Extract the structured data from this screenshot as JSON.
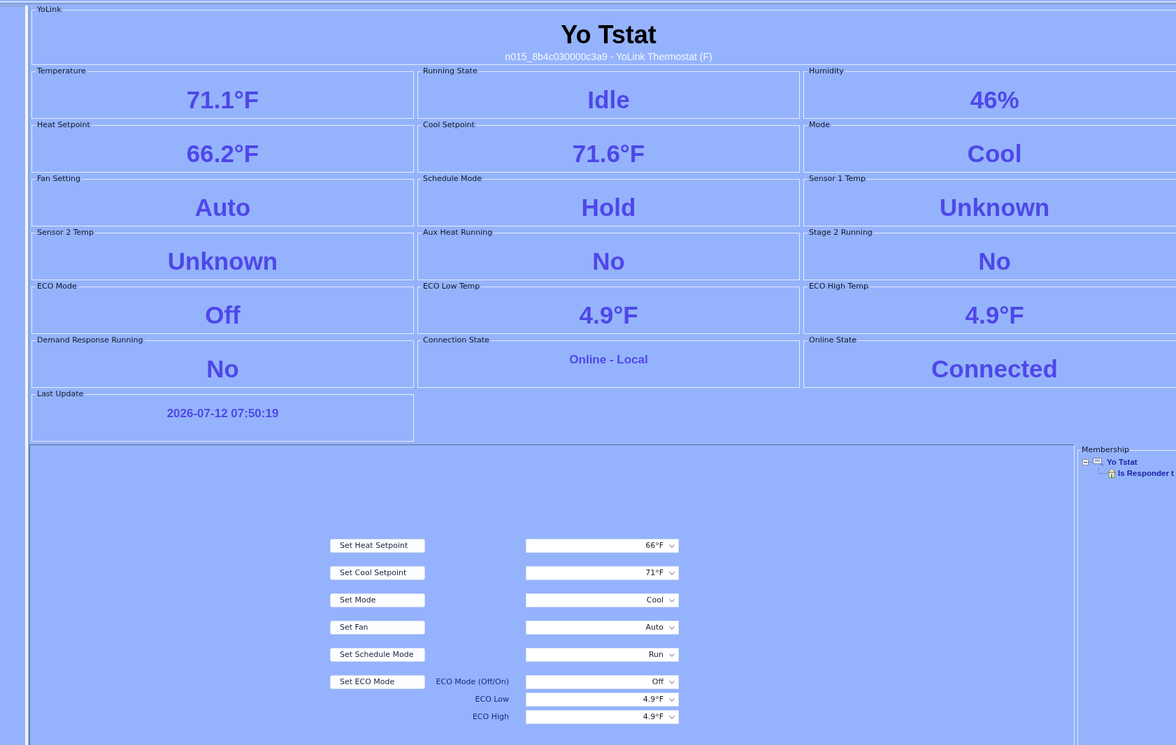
{
  "device_group": {
    "legend": "YoLink",
    "title": "Yo Tstat",
    "subtitle": "n015_8b4c030000c3a9 - YoLink Thermostat (F)"
  },
  "fields": [
    {
      "label": "Temperature",
      "value": "71.1°F",
      "kind": "large"
    },
    {
      "label": "Running State",
      "value": "Idle",
      "kind": "large"
    },
    {
      "label": "Humidity",
      "value": "46%",
      "kind": "large"
    },
    {
      "label": "Heat Setpoint",
      "value": "66.2°F",
      "kind": "large"
    },
    {
      "label": "Cool Setpoint",
      "value": "71.6°F",
      "kind": "large"
    },
    {
      "label": "Mode",
      "value": "Cool",
      "kind": "large"
    },
    {
      "label": "Fan Setting",
      "value": "Auto",
      "kind": "large"
    },
    {
      "label": "Schedule Mode",
      "value": "Hold",
      "kind": "large"
    },
    {
      "label": "Sensor 1 Temp",
      "value": "Unknown",
      "kind": "large"
    },
    {
      "label": "Sensor 2 Temp",
      "value": "Unknown",
      "kind": "large"
    },
    {
      "label": "Aux Heat Running",
      "value": "No",
      "kind": "large"
    },
    {
      "label": "Stage 2 Running",
      "value": "No",
      "kind": "large"
    },
    {
      "label": "ECO Mode",
      "value": "Off",
      "kind": "large"
    },
    {
      "label": "ECO Low Temp",
      "value": "4.9°F",
      "kind": "large"
    },
    {
      "label": "ECO High Temp",
      "value": "4.9°F",
      "kind": "large"
    },
    {
      "label": "Demand Response Running",
      "value": "No",
      "kind": "large"
    },
    {
      "label": "Connection State",
      "value": "Online - Local",
      "kind": "small"
    },
    {
      "label": "Online State",
      "value": "Connected",
      "kind": "large"
    },
    {
      "label": "Last Update",
      "value": "2026-07-12 07:50:19",
      "kind": "small"
    }
  ],
  "controls": [
    {
      "kind": "command",
      "button": "Set Heat Setpoint",
      "value": "66°F"
    },
    {
      "kind": "command",
      "button": "Set Cool Setpoint",
      "value": "71°F"
    },
    {
      "kind": "command",
      "button": "Set Mode",
      "value": "Cool"
    },
    {
      "kind": "command",
      "button": "Set Fan",
      "value": "Auto"
    },
    {
      "kind": "command",
      "button": "Set Schedule Mode",
      "value": "Run"
    },
    {
      "kind": "command",
      "button": "Set ECO Mode",
      "label": "ECO Mode (Off/On)",
      "value": "Off"
    },
    {
      "kind": "parameter",
      "label": "ECO Low",
      "value": "4.9°F"
    },
    {
      "kind": "parameter",
      "label": "ECO High",
      "value": "4.9°F"
    }
  ],
  "membership": {
    "legend": "Membership",
    "tree": [
      {
        "label": "Yo Tstat",
        "expanded": true,
        "children": [
          {
            "label": "Is Responder t"
          }
        ]
      }
    ]
  }
}
